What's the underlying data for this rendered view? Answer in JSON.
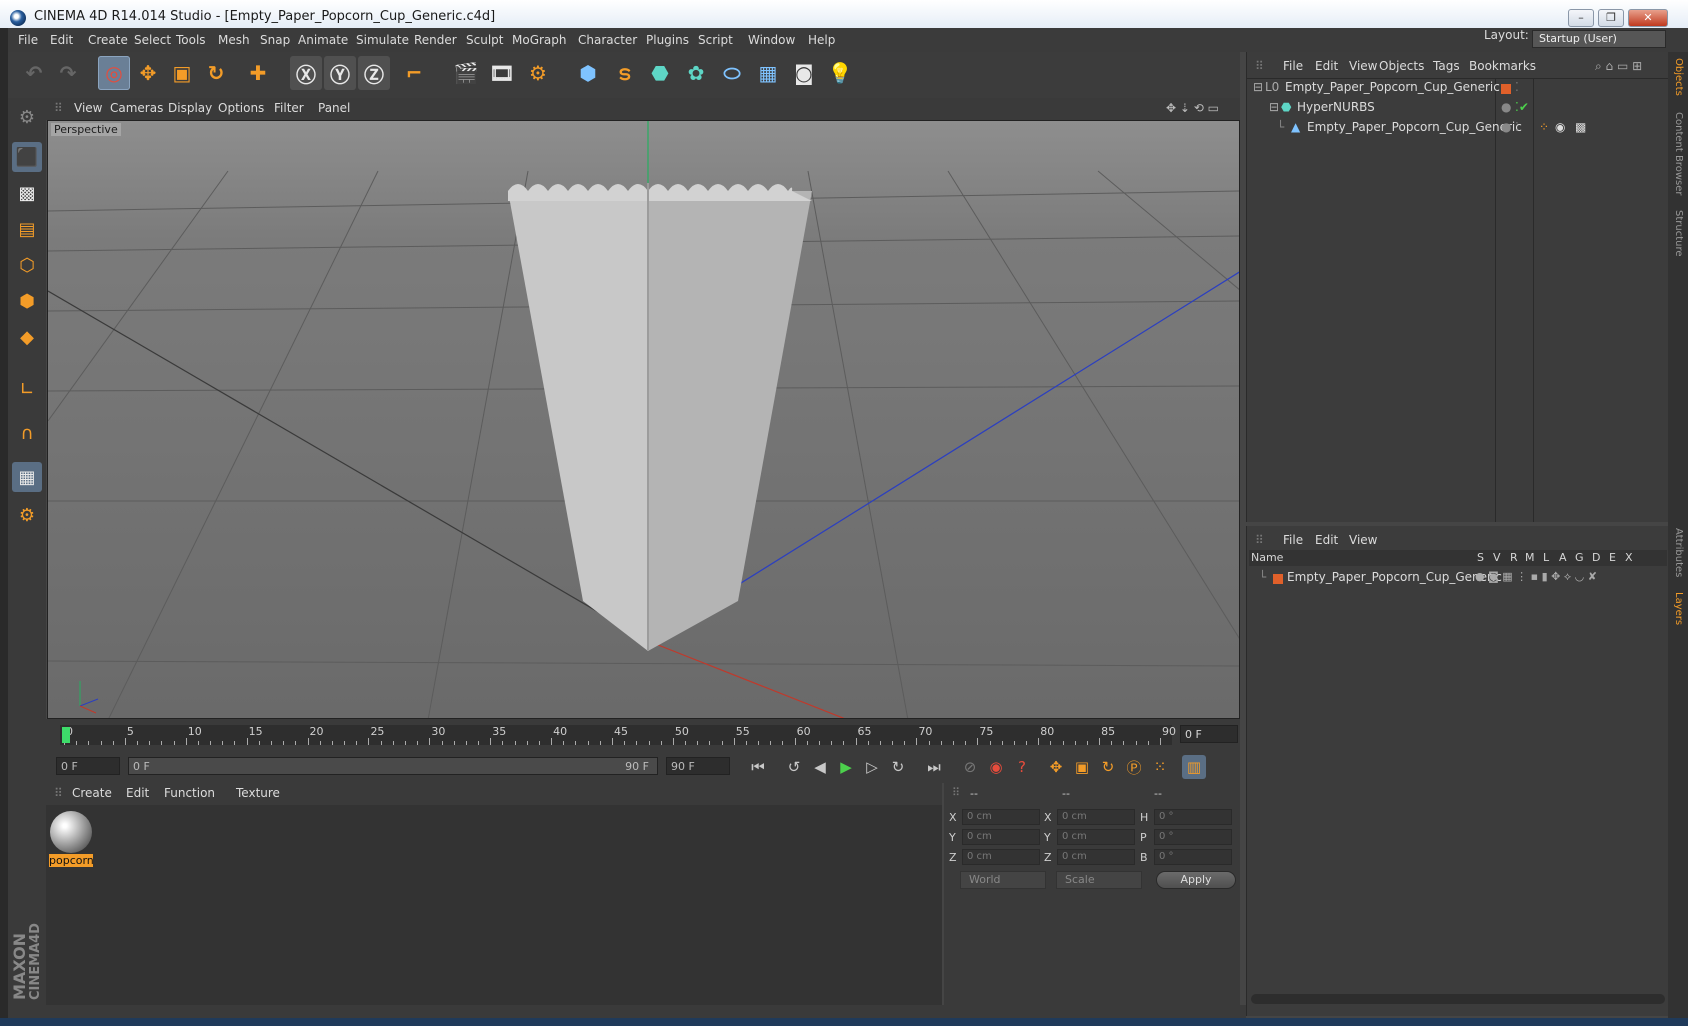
{
  "window": {
    "title": "CINEMA 4D R14.014 Studio - [Empty_Paper_Popcorn_Cup_Generic.c4d]"
  },
  "menubar": {
    "items": [
      "File",
      "Edit",
      "Create",
      "Select",
      "Tools",
      "Mesh",
      "Snap",
      "Animate",
      "Simulate",
      "Render",
      "Sculpt",
      "MoGraph",
      "Character",
      "Plugins",
      "Script",
      "Window",
      "Help"
    ],
    "layout_label": "Layout:",
    "layout_value": "Startup (User)"
  },
  "viewport": {
    "menu": [
      "View",
      "Cameras",
      "Display",
      "Options",
      "Filter",
      "Panel"
    ],
    "label": "Perspective"
  },
  "timeline": {
    "ticks": [
      "0",
      "5",
      "10",
      "15",
      "20",
      "25",
      "30",
      "35",
      "40",
      "45",
      "50",
      "55",
      "60",
      "65",
      "70",
      "75",
      "80",
      "85",
      "90"
    ],
    "current_frame": "0 F"
  },
  "playback": {
    "start_field": "0 F",
    "range_start": "0 F",
    "range_end": "90 F",
    "end_field": "90 F"
  },
  "material_panel": {
    "menu": [
      "Create",
      "Edit",
      "Function",
      "Texture"
    ],
    "material_name": "popcorn"
  },
  "coord_panel": {
    "headers": [
      "--",
      "--",
      "--"
    ],
    "rows": [
      {
        "l1": "X",
        "v1": "0 cm",
        "l2": "X",
        "v2": "0 cm",
        "l3": "H",
        "v3": "0 °"
      },
      {
        "l1": "Y",
        "v1": "0 cm",
        "l2": "Y",
        "v2": "0 cm",
        "l3": "P",
        "v3": "0 °"
      },
      {
        "l1": "Z",
        "v1": "0 cm",
        "l2": "Z",
        "v2": "0 cm",
        "l3": "B",
        "v3": "0 °"
      }
    ],
    "world": "World",
    "scale": "Scale",
    "apply": "Apply"
  },
  "object_manager": {
    "menu": [
      "File",
      "Edit",
      "View",
      "Objects",
      "Tags",
      "Bookmarks"
    ],
    "objects": [
      "Empty_Paper_Popcorn_Cup_Generic",
      "HyperNURBS",
      "Empty_Paper_Popcorn_Cup_Generic"
    ]
  },
  "layer_manager": {
    "menu": [
      "File",
      "Edit",
      "View"
    ],
    "columns": [
      "Name",
      "S",
      "V",
      "R",
      "M",
      "L",
      "A",
      "G",
      "D",
      "E",
      "X"
    ],
    "layers": [
      "Empty_Paper_Popcorn_Cup_Generic"
    ]
  },
  "side_tabs": [
    "Objects",
    "Content Browser",
    "Structure",
    "Attributes",
    "Layers"
  ],
  "branding": {
    "maxon": "MAXON",
    "product": "CINEMA4D"
  },
  "colors": {
    "accent": "#f39c28",
    "highlight": "#6a7f96",
    "x_axis": "#c0392b",
    "y_axis": "#27ae60",
    "z_axis": "#2b3fc0"
  }
}
